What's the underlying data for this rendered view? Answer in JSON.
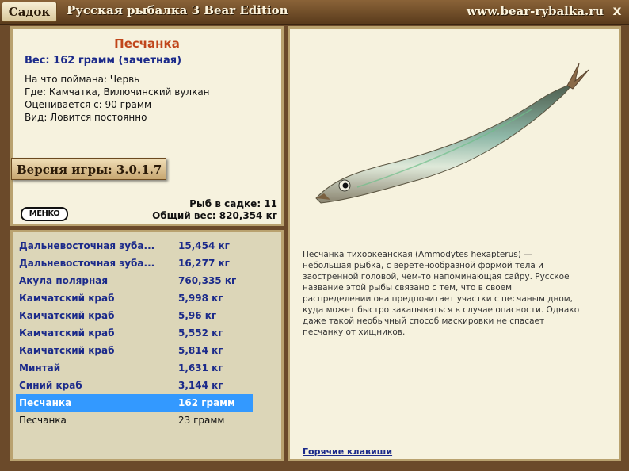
{
  "titlebar": {
    "sadok_label": "Садок",
    "app_title": "Русская рыбалка 3 Bear Edition",
    "site_url": "www.bear-rybalka.ru",
    "close_label": "x"
  },
  "info": {
    "fish_name": "Песчанка",
    "weight_line": "Вес: 162 грамм (зачетная)",
    "caught_on": "На что поймана: Червь",
    "location": "Где: Камчатка, Вилючинский вулкан",
    "valued_from": "Оценивается с: 90 грамм",
    "kind": "Вид: Ловится постоянно",
    "version": "Версия игры: 3.0.1.7",
    "logo_text": "MEHKO",
    "fish_in_keep": "Рыб в садке: 11",
    "total_weight": "Общий вес: 820,354 кг"
  },
  "catch_list": [
    {
      "name": "Дальневосточная зуба...",
      "weight": "15,454 кг"
    },
    {
      "name": "Дальневосточная зуба...",
      "weight": "16,277 кг"
    },
    {
      "name": "Акула полярная",
      "weight": "760,335 кг"
    },
    {
      "name": "Камчатский краб",
      "weight": "5,998 кг"
    },
    {
      "name": "Камчатский краб",
      "weight": "5,96 кг"
    },
    {
      "name": "Камчатский краб",
      "weight": "5,552 кг"
    },
    {
      "name": "Камчатский краб",
      "weight": "5,814 кг"
    },
    {
      "name": "Минтай",
      "weight": "1,631 кг"
    },
    {
      "name": "Синий краб",
      "weight": "3,144 кг"
    },
    {
      "name": "Песчанка",
      "weight": "162 грамм"
    },
    {
      "name": "Песчанка",
      "weight": "23 грамм"
    }
  ],
  "description": "Песчанка тихоокеанская (Ammodytes hexapterus) — небольшая рыбка, с веретенообразной формой тела и заостренной головой, чем-то напоминающая сайру. Русское название этой рыбы связано с тем, что в своем распределении она предпочитает участки с песчаным дном, куда может быстро закапываться в случае опасности. Однако даже такой необычный способ маскировки не спасает песчанку от хищников.",
  "hotkeys_label": "Горячие клавиши",
  "colors": {
    "accent_name": "#c0451a",
    "link_blue": "#1b2a8a",
    "selection": "#3399ff",
    "panel_bg": "#f6f2de",
    "frame_brown": "#6b4a2a"
  }
}
